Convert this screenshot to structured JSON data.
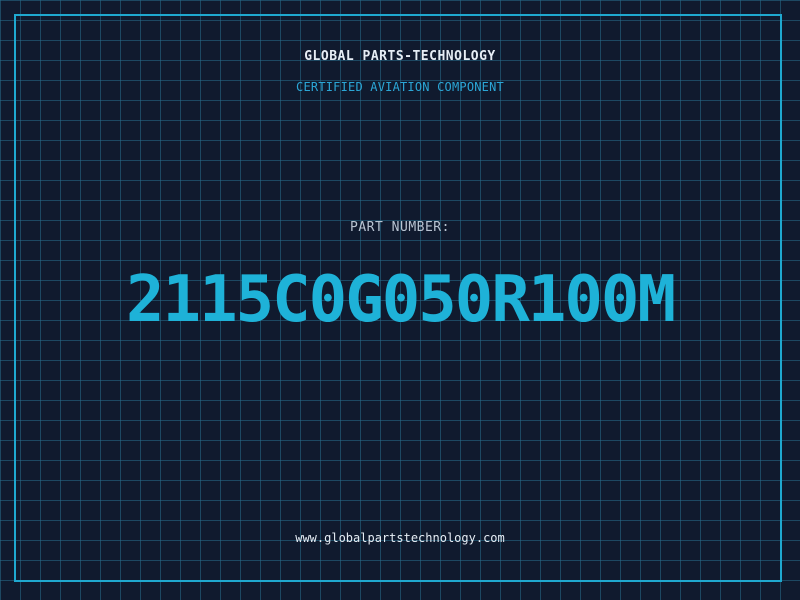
{
  "header": {
    "company_name": "GLOBAL PARTS-TECHNOLOGY",
    "tagline": "CERTIFIED AVIATION COMPONENT"
  },
  "part": {
    "label": "PART NUMBER:",
    "number": "2115C0G050R100M"
  },
  "footer": {
    "website": "www.globalpartstechnology.com"
  },
  "colors": {
    "background": "#101a2e",
    "grid": "#286e8c",
    "frame": "#1fa8cf",
    "accent": "#1eb2d8",
    "text": "#e6edf5"
  }
}
